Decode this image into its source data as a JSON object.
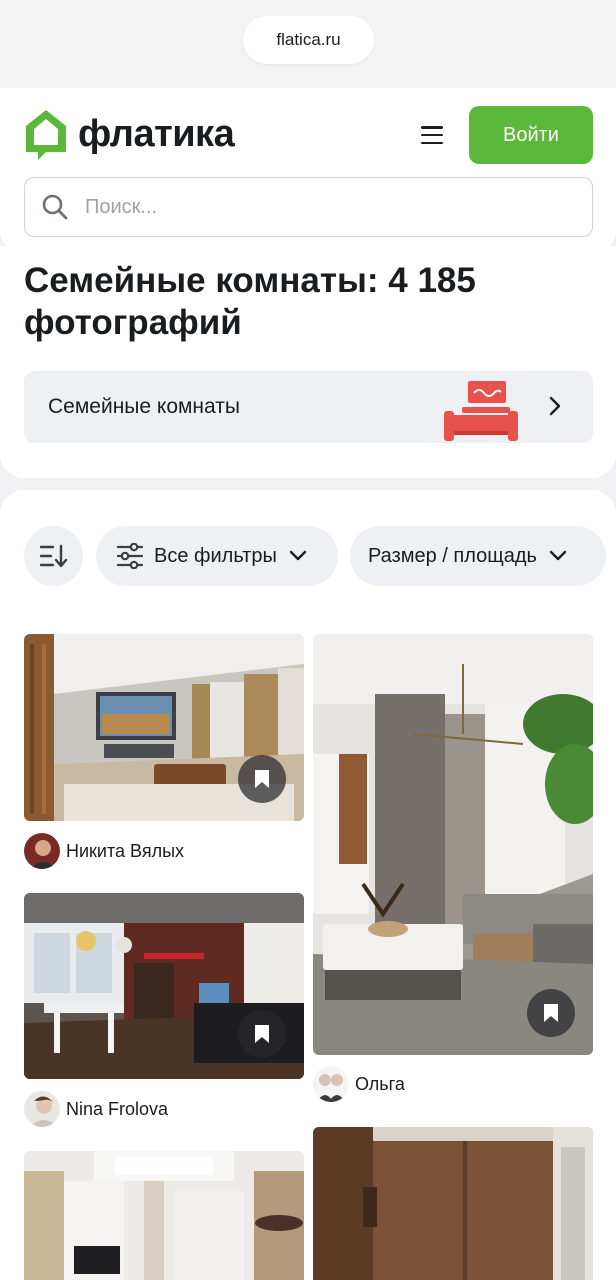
{
  "browser": {
    "url": "flatica.ru"
  },
  "header": {
    "logo_text": "флатика",
    "login_label": "Войти",
    "search_placeholder": "Поиск..."
  },
  "page": {
    "title": "Семейные комнаты: 4 185 фотографий",
    "category_label": "Семейные комнаты"
  },
  "filters": {
    "sort_icon": "sort-icon",
    "all_filters_label": "Все фильтры",
    "size_label": "Размер / площадь"
  },
  "photos": [
    {
      "author": "Никита Вялых"
    },
    {
      "author": "Ольга"
    },
    {
      "author": "Nina Frolova"
    },
    {
      "author": ""
    },
    {
      "author": ""
    }
  ],
  "colors": {
    "brand_green": "#5cb83a",
    "category_art_red": "#e8524d",
    "chip_bg": "#eff0f4"
  }
}
